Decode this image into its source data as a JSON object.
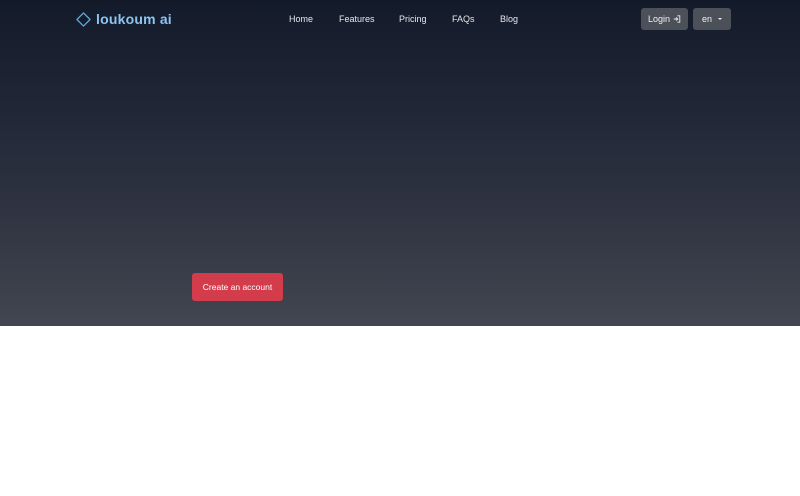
{
  "brand": {
    "name": "loukoum ai",
    "color": "#8ec5f0"
  },
  "nav": {
    "links": [
      {
        "label": "Home"
      },
      {
        "label": "Features"
      },
      {
        "label": "Pricing"
      },
      {
        "label": "FAQs"
      },
      {
        "label": "Blog"
      }
    ],
    "login_label": "Login",
    "language": {
      "selected": "en"
    }
  },
  "hero": {
    "cta_label": "Create an account",
    "cta_color": "#d23c4b"
  },
  "icons": {
    "logo": "diamond-logo-icon",
    "login": "login-arrow-icon",
    "language_caret": "caret-down-icon"
  }
}
